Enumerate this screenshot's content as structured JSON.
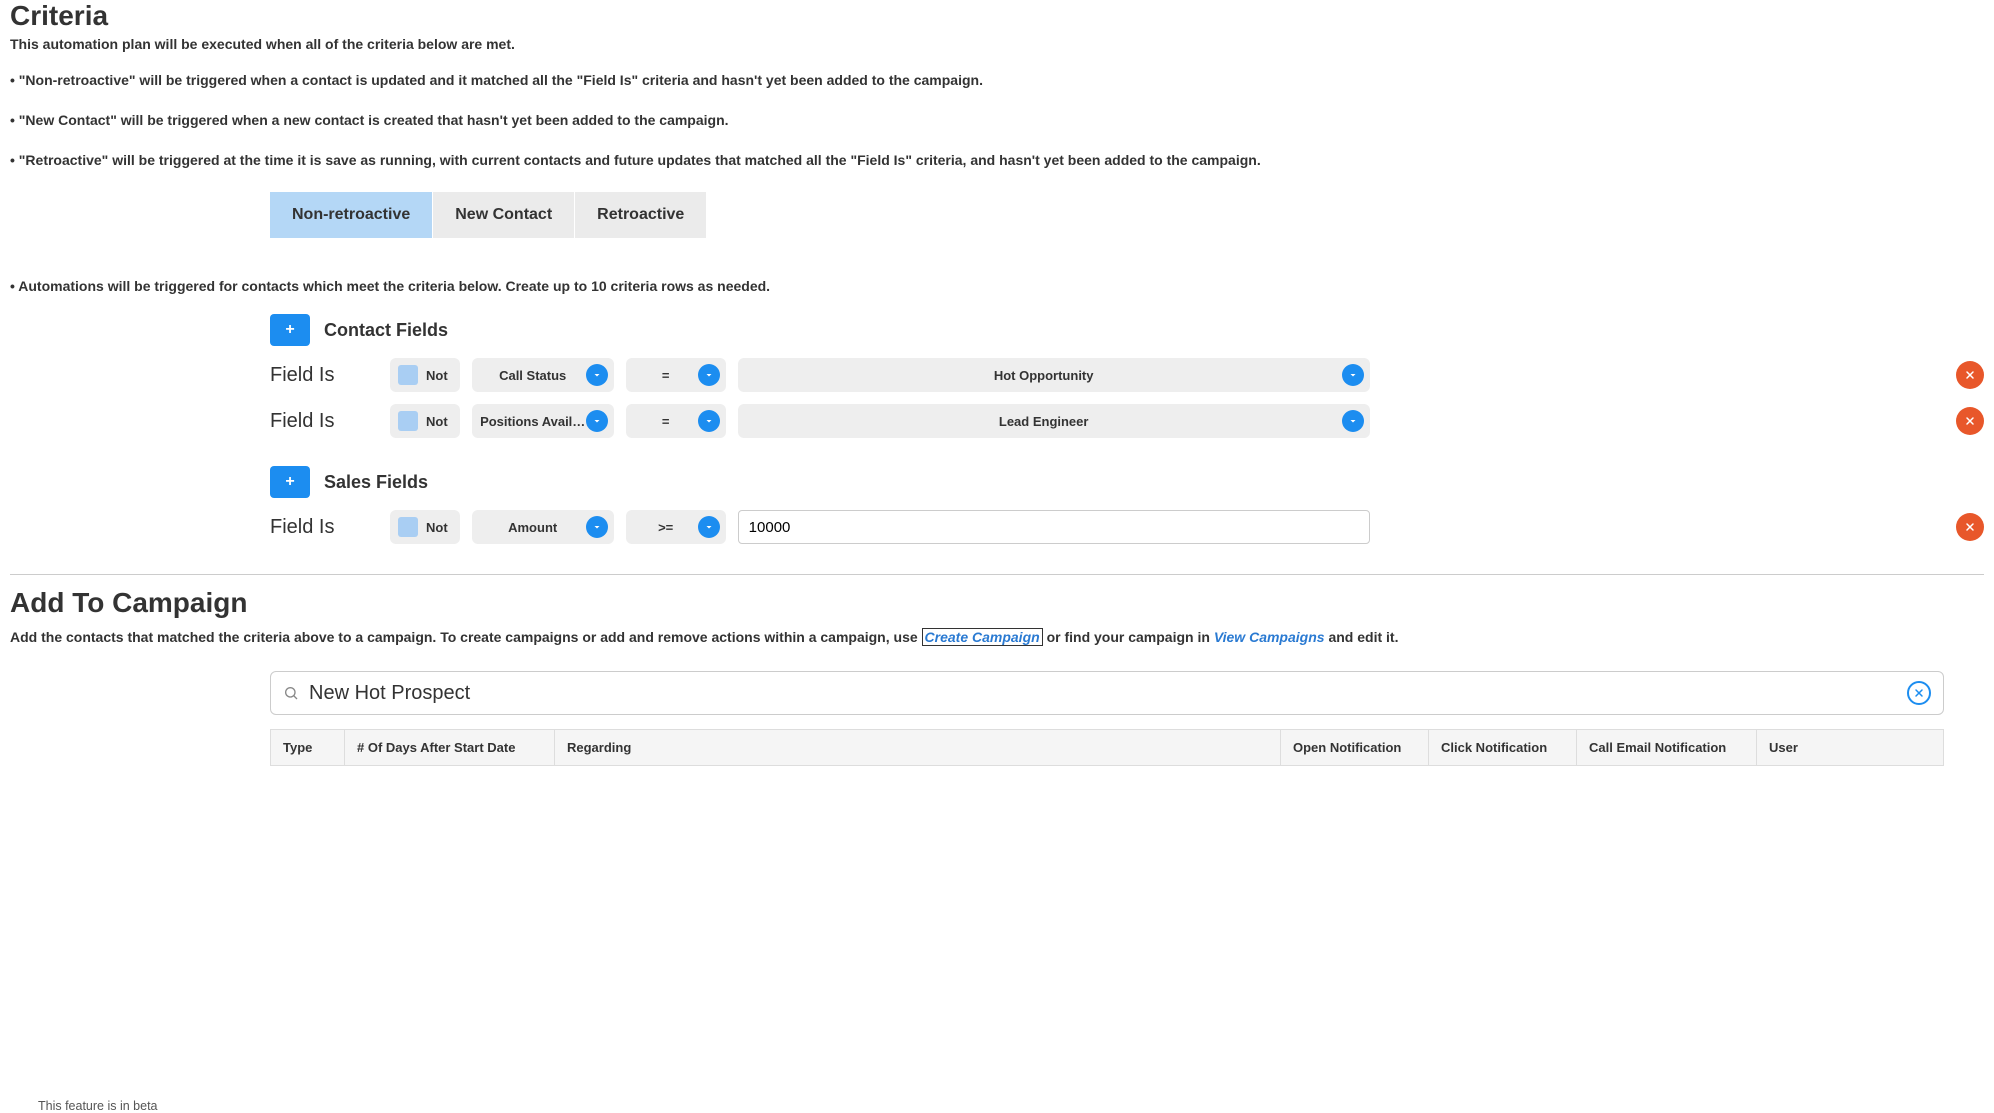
{
  "criteria": {
    "title": "Criteria",
    "intro": "This automation plan will be executed when all of the criteria below are met.",
    "bullet1": "• \"Non-retroactive\" will be triggered when a contact is updated and it matched all the \"Field Is\" criteria and hasn't yet been added to the campaign.",
    "bullet2": "• \"New Contact\" will be triggered when a new contact is created that hasn't yet been added to the campaign.",
    "bullet3": "• \"Retroactive\" will be triggered at the time it is save as running, with current contacts and future updates that matched all the \"Field Is\" criteria, and hasn't yet been added to the campaign.",
    "tabs": {
      "t0": "Non-retroactive",
      "t1": "New Contact",
      "t2": "Retroactive"
    },
    "note": "• Automations will be triggered for contacts which meet the criteria below. Create up to 10 criteria rows as needed.",
    "contact_group": {
      "title": "Contact Fields",
      "rows": [
        {
          "label": "Field Is",
          "not_label": "Not",
          "field": "Call Status",
          "op": "=",
          "value": "Hot Opportunity"
        },
        {
          "label": "Field Is",
          "not_label": "Not",
          "field": "Positions Avail…",
          "op": "=",
          "value": "Lead Engineer"
        }
      ]
    },
    "sales_group": {
      "title": "Sales Fields",
      "rows": [
        {
          "label": "Field Is",
          "not_label": "Not",
          "field": "Amount",
          "op": ">=",
          "value": "10000"
        }
      ]
    }
  },
  "campaign": {
    "title": "Add To Campaign",
    "desc_pre": "Add the contacts that matched the criteria above to a campaign. To create campaigns or add and remove actions within a campaign, use ",
    "create_link": "Create Campaign",
    "desc_mid": " or find your campaign in ",
    "view_link": "View Campaigns",
    "desc_post": " and edit it.",
    "search_value": "New Hot Prospect",
    "table": {
      "h_type": "Type",
      "h_days": "# Of Days After Start Date",
      "h_regarding": "Regarding",
      "h_open": "Open Notification",
      "h_click": "Click Notification",
      "h_email": "Call Email Notification",
      "h_user": "User"
    }
  },
  "beta_note": "This feature is in beta"
}
